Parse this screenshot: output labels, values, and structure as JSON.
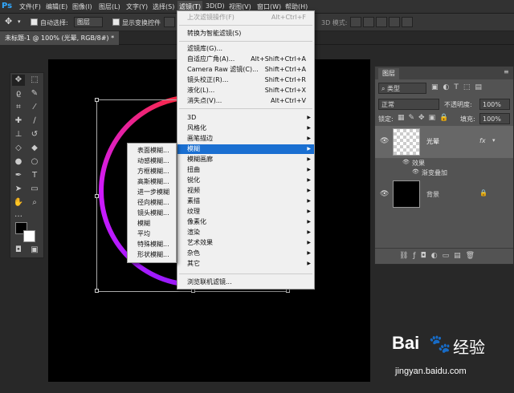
{
  "app": {
    "logo": "Ps"
  },
  "menubar": {
    "items": [
      {
        "label": "文件(F)"
      },
      {
        "label": "编辑(E)"
      },
      {
        "label": "图像(I)"
      },
      {
        "label": "图层(L)"
      },
      {
        "label": "文字(Y)"
      },
      {
        "label": "选择(S)"
      },
      {
        "label": "滤镜(T)"
      },
      {
        "label": "3D(D)"
      },
      {
        "label": "视图(V)"
      },
      {
        "label": "窗口(W)"
      },
      {
        "label": "帮助(H)"
      }
    ]
  },
  "options": {
    "auto_select_label": "自动选择:",
    "auto_select_value": "图层",
    "show_transform_label": "显示变换控件",
    "mode_3d_label": "3D 模式:"
  },
  "document": {
    "tab_title": "未标题-1 @ 100% (光晕, RGB/8#) *"
  },
  "filter_menu": {
    "items": [
      {
        "label": "上次滤镜操作(F)",
        "shortcut": "Alt+Ctrl+F",
        "disabled": true
      },
      {
        "label": "转换为智能滤镜(S)"
      },
      {
        "label": "滤镜库(G)..."
      },
      {
        "label": "自适应广角(A)...",
        "shortcut": "Alt+Shift+Ctrl+A"
      },
      {
        "label": "Camera Raw 滤镜(C)...",
        "shortcut": "Shift+Ctrl+A"
      },
      {
        "label": "镜头校正(R)...",
        "shortcut": "Shift+Ctrl+R"
      },
      {
        "label": "液化(L)...",
        "shortcut": "Shift+Ctrl+X"
      },
      {
        "label": "消失点(V)...",
        "shortcut": "Alt+Ctrl+V"
      },
      {
        "label": "3D"
      },
      {
        "label": "风格化"
      },
      {
        "label": "画笔描边"
      },
      {
        "label": "模糊"
      },
      {
        "label": "模糊画廊"
      },
      {
        "label": "扭曲"
      },
      {
        "label": "锐化"
      },
      {
        "label": "视频"
      },
      {
        "label": "素描"
      },
      {
        "label": "纹理"
      },
      {
        "label": "像素化"
      },
      {
        "label": "渲染"
      },
      {
        "label": "艺术效果"
      },
      {
        "label": "杂色"
      },
      {
        "label": "其它"
      },
      {
        "label": "浏览联机滤镜..."
      }
    ]
  },
  "blur_submenu": {
    "items": [
      "表面模糊...",
      "动感模糊...",
      "方框模糊...",
      "高斯模糊...",
      "进一步模糊",
      "径向模糊...",
      "镜头模糊...",
      "模糊",
      "平均",
      "特殊模糊...",
      "形状模糊..."
    ]
  },
  "layers_panel": {
    "tab": "图层",
    "kind_filter": "类型",
    "blend_mode": "正常",
    "opacity_label": "不透明度:",
    "opacity_value": "100%",
    "lock_label": "锁定:",
    "fill_label": "填充:",
    "fill_value": "100%",
    "layers": [
      {
        "name": "光晕",
        "fx": "fx"
      },
      {
        "name": "背景"
      }
    ],
    "effects_label": "效果",
    "effect_name": "渐变叠加"
  },
  "watermark": {
    "brand": "Bai",
    "brand2": "经验",
    "url": "jingyan.baidu.com"
  },
  "colors": {
    "accent": "#1a6fd1",
    "ring_red": "#ff2a2a",
    "ring_purple": "#9a1aff"
  }
}
